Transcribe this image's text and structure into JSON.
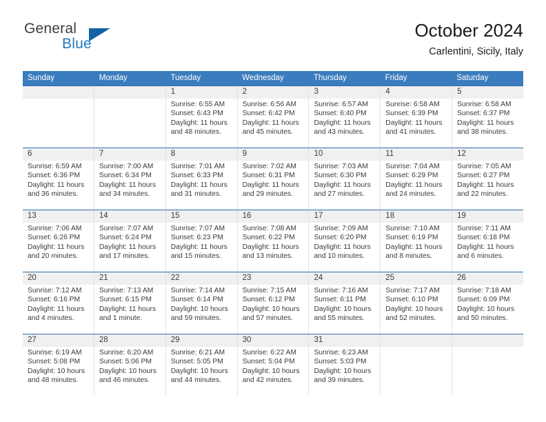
{
  "brand": {
    "line1": "General",
    "line2": "Blue",
    "triangle_color": "#1461a8",
    "blue_text_color": "#1f7ac4"
  },
  "header": {
    "title": "October 2024",
    "location": "Carlentini, Sicily, Italy"
  },
  "theme": {
    "header_band": "#3a7cbe",
    "row_rule": "#2d6ca8",
    "daynum_band": "#f0f0f0",
    "text": "#3a3a3a"
  },
  "weekdays": [
    "Sunday",
    "Monday",
    "Tuesday",
    "Wednesday",
    "Thursday",
    "Friday",
    "Saturday"
  ],
  "labels": {
    "sunrise_prefix": "Sunrise:",
    "sunset_prefix": "Sunset:",
    "daylight_prefix": "Daylight:"
  },
  "weeks": [
    [
      {
        "empty": true
      },
      {
        "empty": true
      },
      {
        "day": "1",
        "sunrise": "Sunrise: 6:55 AM",
        "sunset": "Sunset: 6:43 PM",
        "daylight": "Daylight: 11 hours and 48 minutes."
      },
      {
        "day": "2",
        "sunrise": "Sunrise: 6:56 AM",
        "sunset": "Sunset: 6:42 PM",
        "daylight": "Daylight: 11 hours and 45 minutes."
      },
      {
        "day": "3",
        "sunrise": "Sunrise: 6:57 AM",
        "sunset": "Sunset: 6:40 PM",
        "daylight": "Daylight: 11 hours and 43 minutes."
      },
      {
        "day": "4",
        "sunrise": "Sunrise: 6:58 AM",
        "sunset": "Sunset: 6:39 PM",
        "daylight": "Daylight: 11 hours and 41 minutes."
      },
      {
        "day": "5",
        "sunrise": "Sunrise: 6:58 AM",
        "sunset": "Sunset: 6:37 PM",
        "daylight": "Daylight: 11 hours and 38 minutes."
      }
    ],
    [
      {
        "day": "6",
        "sunrise": "Sunrise: 6:59 AM",
        "sunset": "Sunset: 6:36 PM",
        "daylight": "Daylight: 11 hours and 36 minutes."
      },
      {
        "day": "7",
        "sunrise": "Sunrise: 7:00 AM",
        "sunset": "Sunset: 6:34 PM",
        "daylight": "Daylight: 11 hours and 34 minutes."
      },
      {
        "day": "8",
        "sunrise": "Sunrise: 7:01 AM",
        "sunset": "Sunset: 6:33 PM",
        "daylight": "Daylight: 11 hours and 31 minutes."
      },
      {
        "day": "9",
        "sunrise": "Sunrise: 7:02 AM",
        "sunset": "Sunset: 6:31 PM",
        "daylight": "Daylight: 11 hours and 29 minutes."
      },
      {
        "day": "10",
        "sunrise": "Sunrise: 7:03 AM",
        "sunset": "Sunset: 6:30 PM",
        "daylight": "Daylight: 11 hours and 27 minutes."
      },
      {
        "day": "11",
        "sunrise": "Sunrise: 7:04 AM",
        "sunset": "Sunset: 6:29 PM",
        "daylight": "Daylight: 11 hours and 24 minutes."
      },
      {
        "day": "12",
        "sunrise": "Sunrise: 7:05 AM",
        "sunset": "Sunset: 6:27 PM",
        "daylight": "Daylight: 11 hours and 22 minutes."
      }
    ],
    [
      {
        "day": "13",
        "sunrise": "Sunrise: 7:06 AM",
        "sunset": "Sunset: 6:26 PM",
        "daylight": "Daylight: 11 hours and 20 minutes."
      },
      {
        "day": "14",
        "sunrise": "Sunrise: 7:07 AM",
        "sunset": "Sunset: 6:24 PM",
        "daylight": "Daylight: 11 hours and 17 minutes."
      },
      {
        "day": "15",
        "sunrise": "Sunrise: 7:07 AM",
        "sunset": "Sunset: 6:23 PM",
        "daylight": "Daylight: 11 hours and 15 minutes."
      },
      {
        "day": "16",
        "sunrise": "Sunrise: 7:08 AM",
        "sunset": "Sunset: 6:22 PM",
        "daylight": "Daylight: 11 hours and 13 minutes."
      },
      {
        "day": "17",
        "sunrise": "Sunrise: 7:09 AM",
        "sunset": "Sunset: 6:20 PM",
        "daylight": "Daylight: 11 hours and 10 minutes."
      },
      {
        "day": "18",
        "sunrise": "Sunrise: 7:10 AM",
        "sunset": "Sunset: 6:19 PM",
        "daylight": "Daylight: 11 hours and 8 minutes."
      },
      {
        "day": "19",
        "sunrise": "Sunrise: 7:11 AM",
        "sunset": "Sunset: 6:18 PM",
        "daylight": "Daylight: 11 hours and 6 minutes."
      }
    ],
    [
      {
        "day": "20",
        "sunrise": "Sunrise: 7:12 AM",
        "sunset": "Sunset: 6:16 PM",
        "daylight": "Daylight: 11 hours and 4 minutes."
      },
      {
        "day": "21",
        "sunrise": "Sunrise: 7:13 AM",
        "sunset": "Sunset: 6:15 PM",
        "daylight": "Daylight: 11 hours and 1 minute."
      },
      {
        "day": "22",
        "sunrise": "Sunrise: 7:14 AM",
        "sunset": "Sunset: 6:14 PM",
        "daylight": "Daylight: 10 hours and 59 minutes."
      },
      {
        "day": "23",
        "sunrise": "Sunrise: 7:15 AM",
        "sunset": "Sunset: 6:12 PM",
        "daylight": "Daylight: 10 hours and 57 minutes."
      },
      {
        "day": "24",
        "sunrise": "Sunrise: 7:16 AM",
        "sunset": "Sunset: 6:11 PM",
        "daylight": "Daylight: 10 hours and 55 minutes."
      },
      {
        "day": "25",
        "sunrise": "Sunrise: 7:17 AM",
        "sunset": "Sunset: 6:10 PM",
        "daylight": "Daylight: 10 hours and 52 minutes."
      },
      {
        "day": "26",
        "sunrise": "Sunrise: 7:18 AM",
        "sunset": "Sunset: 6:09 PM",
        "daylight": "Daylight: 10 hours and 50 minutes."
      }
    ],
    [
      {
        "day": "27",
        "sunrise": "Sunrise: 6:19 AM",
        "sunset": "Sunset: 5:08 PM",
        "daylight": "Daylight: 10 hours and 48 minutes."
      },
      {
        "day": "28",
        "sunrise": "Sunrise: 6:20 AM",
        "sunset": "Sunset: 5:06 PM",
        "daylight": "Daylight: 10 hours and 46 minutes."
      },
      {
        "day": "29",
        "sunrise": "Sunrise: 6:21 AM",
        "sunset": "Sunset: 5:05 PM",
        "daylight": "Daylight: 10 hours and 44 minutes."
      },
      {
        "day": "30",
        "sunrise": "Sunrise: 6:22 AM",
        "sunset": "Sunset: 5:04 PM",
        "daylight": "Daylight: 10 hours and 42 minutes."
      },
      {
        "day": "31",
        "sunrise": "Sunrise: 6:23 AM",
        "sunset": "Sunset: 5:03 PM",
        "daylight": "Daylight: 10 hours and 39 minutes."
      },
      {
        "empty": true
      },
      {
        "empty": true
      }
    ]
  ]
}
